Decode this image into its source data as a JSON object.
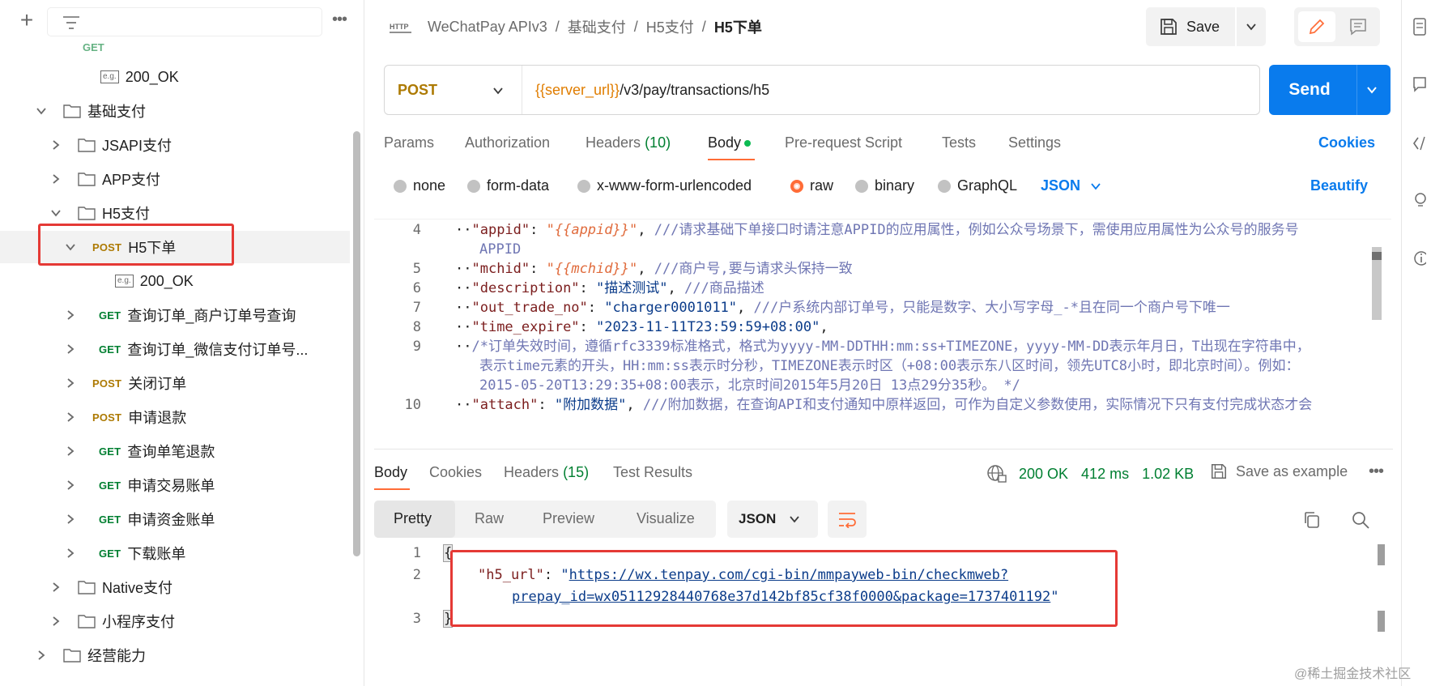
{
  "sidebar": {
    "items": [
      {
        "kind": "example",
        "label": "200_OK"
      },
      {
        "kind": "folder",
        "label": "基础支付"
      },
      {
        "kind": "folder",
        "label": "JSAPI支付"
      },
      {
        "kind": "folder",
        "label": "APP支付"
      },
      {
        "kind": "folder",
        "label": "H5支付"
      },
      {
        "kind": "request",
        "method": "POST",
        "label": "H5下单"
      },
      {
        "kind": "example",
        "label": "200_OK"
      },
      {
        "kind": "request",
        "method": "GET",
        "label": "查询订单_商户订单号查询"
      },
      {
        "kind": "request",
        "method": "GET",
        "label": "查询订单_微信支付订单号..."
      },
      {
        "kind": "request",
        "method": "POST",
        "label": "关闭订单"
      },
      {
        "kind": "request",
        "method": "POST",
        "label": "申请退款"
      },
      {
        "kind": "request",
        "method": "GET",
        "label": "查询单笔退款"
      },
      {
        "kind": "request",
        "method": "GET",
        "label": "申请交易账单"
      },
      {
        "kind": "request",
        "method": "GET",
        "label": "申请资金账单"
      },
      {
        "kind": "request",
        "method": "GET",
        "label": "下载账单"
      },
      {
        "kind": "folder",
        "label": "Native支付"
      },
      {
        "kind": "folder",
        "label": "小程序支付"
      },
      {
        "kind": "folder",
        "label": "经营能力"
      }
    ],
    "example_badge": "e.g."
  },
  "header": {
    "breadcrumb": [
      "WeChatPay APIv3",
      "基础支付",
      "H5支付"
    ],
    "current": "H5下单",
    "save_label": "Save"
  },
  "request": {
    "method": "POST",
    "url_var": "{{server_url}}",
    "url_path": "/v3/pay/transactions/h5",
    "send_label": "Send",
    "tabs": {
      "params": "Params",
      "authorization": "Authorization",
      "headers": "Headers",
      "headers_count": "(10)",
      "body": "Body",
      "prerequest": "Pre-request Script",
      "tests": "Tests",
      "settings": "Settings"
    },
    "cookies_label": "Cookies",
    "body_types": {
      "none": "none",
      "form_data": "form-data",
      "urlencoded": "x-www-form-urlencoded",
      "raw": "raw",
      "binary": "binary",
      "graphql": "GraphQL"
    },
    "format": "JSON",
    "beautify_label": "Beautify",
    "code": {
      "l4_num": "4",
      "l4_key": "\"appid\"",
      "l4_val": "\"{{appid}}\"",
      "l4_comment": "///请求基础下单接口时请注意APPID的应用属性，例如公众号场景下，需使用应用属性为公众号的服务号",
      "l4_cont": "APPID",
      "l5_num": "5",
      "l5_key": "\"mchid\"",
      "l5_val": "\"{{mchid}}\"",
      "l5_comment": "///商户号,要与请求头保持一致",
      "l6_num": "6",
      "l6_key": "\"description\"",
      "l6_val": "\"描述测试\"",
      "l6_comment": "///商品描述",
      "l7_num": "7",
      "l7_key": "\"out_trade_no\"",
      "l7_val": "\"charger0001011\"",
      "l7_comment": "///户系统内部订单号，只能是数字、大小写字母_-*且在同一个商户号下唯一",
      "l8_num": "8",
      "l8_key": "\"time_expire\"",
      "l8_val": "\"2023-11-11T23:59:59+08:00\"",
      "l9_num": "9",
      "l9_a": "/*订单失效时间，遵循rfc3339标准格式，格式为yyyy-MM-DDTHH:mm:ss+TIMEZONE，yyyy-MM-DD表示年月日，T出现在字符串中，",
      "l9_b": "表示time元素的开头，HH:mm:ss表示时分秒，TIMEZONE表示时区（+08:00表示东八区时间，领先UTC8小时，即北京时间）。例如：",
      "l9_c": "2015-05-20T13:29:35+08:00表示，北京时间2015年5月20日 13点29分35秒。 */",
      "l10_num": "10",
      "l10_key": "\"attach\"",
      "l10_val": "\"附加数据\"",
      "l10_comment": "///附加数据，在查询API和支付通知中原样返回，可作为自定义参数使用，实际情况下只有支付完成状态才会"
    }
  },
  "response": {
    "tabs": {
      "body": "Body",
      "cookies": "Cookies",
      "headers": "Headers",
      "headers_count": "(15)",
      "test_results": "Test Results"
    },
    "status": "200 OK",
    "time": "412 ms",
    "size": "1.02 KB",
    "save_example_label": "Save as example",
    "views": {
      "pretty": "Pretty",
      "raw": "Raw",
      "preview": "Preview",
      "visualize": "Visualize"
    },
    "format": "JSON",
    "code": {
      "l1_num": "1",
      "l1_text": "{",
      "l2_num": "2",
      "l2_key": "\"h5_url\"",
      "l2_url_a": "https://wx.tenpay.com/cgi-bin/mmpayweb-bin/checkmweb?",
      "l2_url_b": "prepay_id=wx05112928440768e37d142bf85cf38f0000&package=1737401192",
      "l3_num": "3",
      "l3_text": "}"
    }
  },
  "watermark": "@稀土掘金技术社区",
  "colors": {
    "accent": "#ff6c37",
    "send": "#097bed",
    "post": "#ad7a03",
    "get": "#007f31",
    "highlight": "#e53935"
  }
}
